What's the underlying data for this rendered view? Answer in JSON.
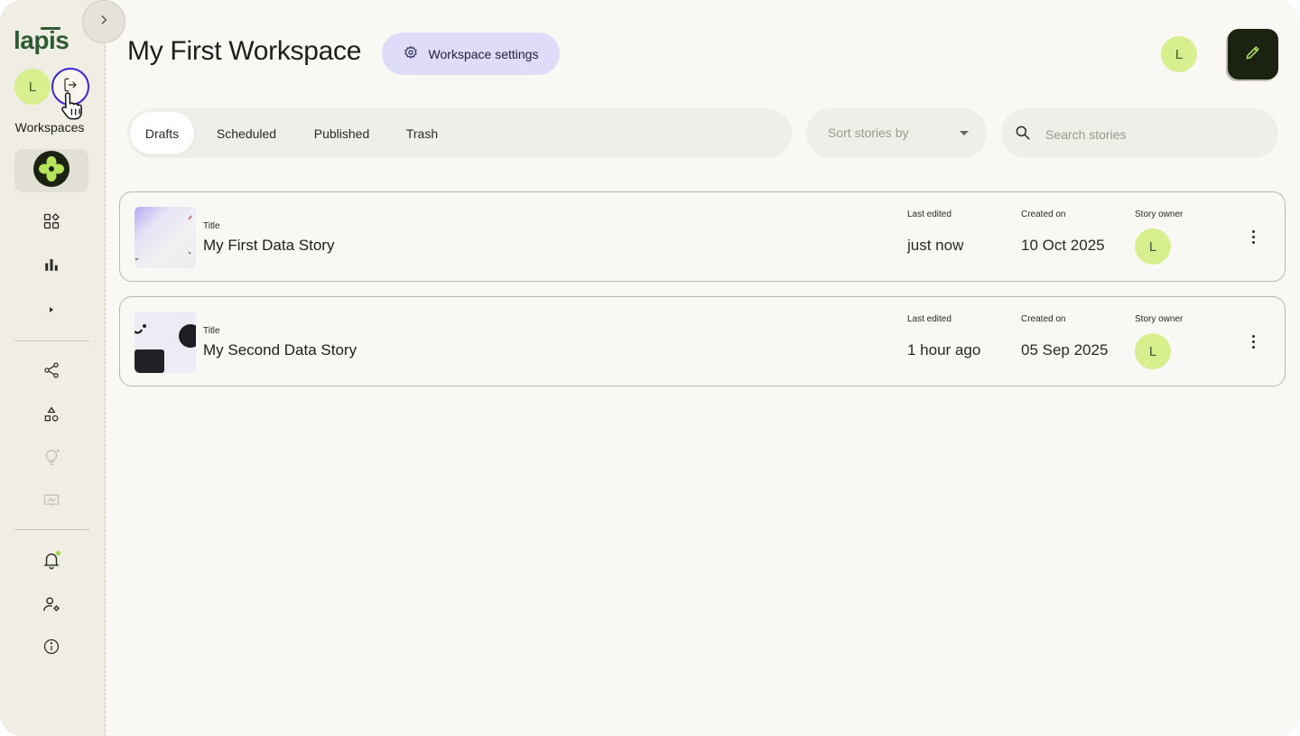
{
  "brand": {
    "logo_text": "lapis"
  },
  "user": {
    "initial": "L"
  },
  "sidebar": {
    "workspaces_label": "Workspaces",
    "icons": [
      "chevron-right-icon",
      "logout-icon",
      "workspace-logo-icon",
      "dashboard-grid-icon",
      "bar-chart-icon",
      "caret-right-icon",
      "share-icon",
      "shapes-icon",
      "lightbulb-icon",
      "presentation-icon",
      "bell-icon",
      "user-settings-icon",
      "info-icon"
    ],
    "notification_dot_color": "#a6d95a"
  },
  "header": {
    "title": "My First Workspace",
    "settings_label": "Workspace settings"
  },
  "tabs": [
    {
      "label": "Drafts",
      "active": true
    },
    {
      "label": "Scheduled",
      "active": false
    },
    {
      "label": "Published",
      "active": false
    },
    {
      "label": "Trash",
      "active": false
    }
  ],
  "sort": {
    "placeholder": "Sort stories by"
  },
  "search": {
    "placeholder": "Search stories"
  },
  "columns": {
    "title": "Title",
    "last_edited": "Last edited",
    "created_on": "Created on",
    "owner": "Story owner"
  },
  "stories": [
    {
      "title": "My First Data Story",
      "last_edited": "just now",
      "created_on": "10 Oct 2025",
      "owner_initial": "L"
    },
    {
      "title": "My Second Data Story",
      "last_edited": "1 hour ago",
      "created_on": "05 Sep 2025",
      "owner_initial": "L"
    }
  ],
  "colors": {
    "accent_avatar": "#d7ef8f",
    "settings_button": "#dedcf9",
    "edit_button": "#1b2211",
    "focus_ring": "#3d22d6"
  }
}
